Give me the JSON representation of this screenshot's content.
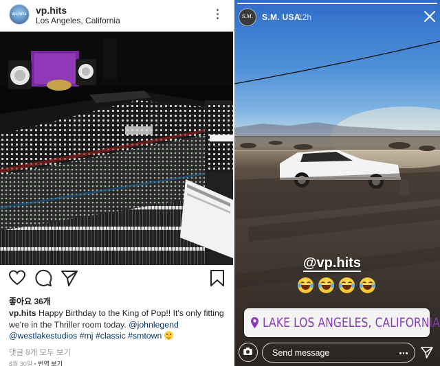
{
  "post": {
    "username": "vp.hits",
    "location": "Los Angeles, California",
    "avatar_text": "vp.hits",
    "likes": "좋아요 36개",
    "caption_user": "vp.hits",
    "caption_text": "Happy Birthday to the King of Pop!! It's only fitting we're in the Thriller room today.",
    "caption_tags": [
      "@johnlegend",
      "@westlakestudios",
      "#mj",
      "#classic",
      "#smtown"
    ],
    "caption_emoji": "smiling-face-emoji",
    "comments_link": "댓글 8개 모두 보기",
    "date": "8월 30일",
    "date_separator": "•",
    "see_translation": "번역 보기",
    "photo_description_icon": "mixing-console-photo",
    "icons": {
      "like": "heart-icon",
      "comment": "comment-icon",
      "share": "send-icon",
      "save": "bookmark-icon",
      "more": "more-icon"
    }
  },
  "story": {
    "username": "S.M. USA",
    "time": "12h",
    "avatar_text": "S.M.",
    "mention": "@vp.hits",
    "laugh_emoji_count": 4,
    "location_sticker": "LAKE LOS ANGELES, CALIFORNIA",
    "send_placeholder": "Send message",
    "icons": {
      "close": "close-icon",
      "camera": "camera-icon",
      "send": "send-icon",
      "location": "location-pin-icon",
      "more": "more-icon"
    }
  },
  "colors": {
    "text_primary": "#262626",
    "link": "#003569",
    "secondary": "#999999",
    "location_sticker_text": "#8a3ab9",
    "story_sky_top": "#2f6cc7",
    "emoji_yellow": "#f7c531"
  }
}
